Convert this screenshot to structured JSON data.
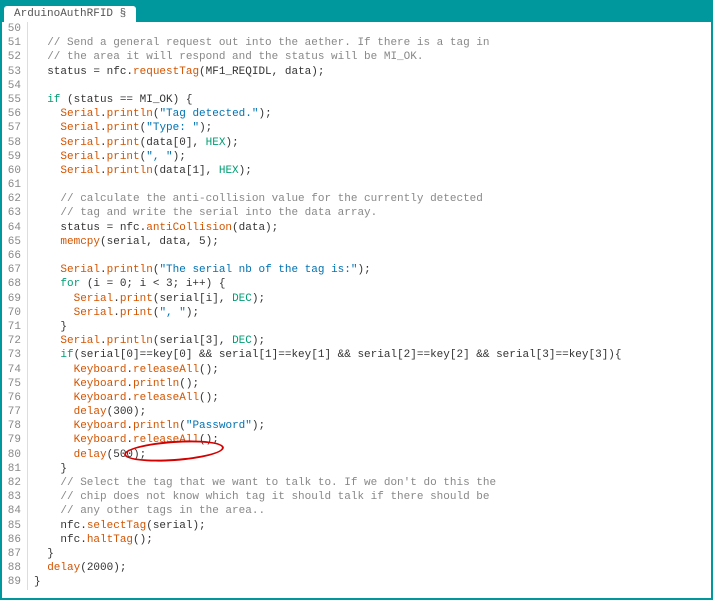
{
  "tab": {
    "label": "ArduinoAuthRFID §"
  },
  "lines": [
    {
      "n": 50,
      "tokens": []
    },
    {
      "n": 51,
      "tokens": [
        {
          "t": "  ",
          "c": "c-black"
        },
        {
          "t": "// Send a general request out into the aether. If there is a tag in",
          "c": "c-comment"
        }
      ]
    },
    {
      "n": 52,
      "tokens": [
        {
          "t": "  ",
          "c": "c-black"
        },
        {
          "t": "// the area it will respond and the status will be MI_OK.",
          "c": "c-comment"
        }
      ]
    },
    {
      "n": 53,
      "tokens": [
        {
          "t": "  status = nfc.",
          "c": "c-black"
        },
        {
          "t": "requestTag",
          "c": "c-orange"
        },
        {
          "t": "(MF1_REQIDL, data);",
          "c": "c-black"
        }
      ]
    },
    {
      "n": 54,
      "tokens": []
    },
    {
      "n": 55,
      "tokens": [
        {
          "t": "  ",
          "c": "c-black"
        },
        {
          "t": "if",
          "c": "c-teal"
        },
        {
          "t": " (status == MI_OK) {",
          "c": "c-black"
        }
      ]
    },
    {
      "n": 56,
      "tokens": [
        {
          "t": "    ",
          "c": "c-black"
        },
        {
          "t": "Serial",
          "c": "c-orange"
        },
        {
          "t": ".",
          "c": "c-black"
        },
        {
          "t": "println",
          "c": "c-orange"
        },
        {
          "t": "(",
          "c": "c-black"
        },
        {
          "t": "\"Tag detected.\"",
          "c": "c-blue"
        },
        {
          "t": ");",
          "c": "c-black"
        }
      ]
    },
    {
      "n": 57,
      "tokens": [
        {
          "t": "    ",
          "c": "c-black"
        },
        {
          "t": "Serial",
          "c": "c-orange"
        },
        {
          "t": ".",
          "c": "c-black"
        },
        {
          "t": "print",
          "c": "c-orange"
        },
        {
          "t": "(",
          "c": "c-black"
        },
        {
          "t": "\"Type: \"",
          "c": "c-blue"
        },
        {
          "t": ");",
          "c": "c-black"
        }
      ]
    },
    {
      "n": 58,
      "tokens": [
        {
          "t": "    ",
          "c": "c-black"
        },
        {
          "t": "Serial",
          "c": "c-orange"
        },
        {
          "t": ".",
          "c": "c-black"
        },
        {
          "t": "print",
          "c": "c-orange"
        },
        {
          "t": "(data[0], ",
          "c": "c-black"
        },
        {
          "t": "HEX",
          "c": "c-teal"
        },
        {
          "t": ");",
          "c": "c-black"
        }
      ]
    },
    {
      "n": 59,
      "tokens": [
        {
          "t": "    ",
          "c": "c-black"
        },
        {
          "t": "Serial",
          "c": "c-orange"
        },
        {
          "t": ".",
          "c": "c-black"
        },
        {
          "t": "print",
          "c": "c-orange"
        },
        {
          "t": "(",
          "c": "c-black"
        },
        {
          "t": "\", \"",
          "c": "c-blue"
        },
        {
          "t": ");",
          "c": "c-black"
        }
      ]
    },
    {
      "n": 60,
      "tokens": [
        {
          "t": "    ",
          "c": "c-black"
        },
        {
          "t": "Serial",
          "c": "c-orange"
        },
        {
          "t": ".",
          "c": "c-black"
        },
        {
          "t": "println",
          "c": "c-orange"
        },
        {
          "t": "(data[1], ",
          "c": "c-black"
        },
        {
          "t": "HEX",
          "c": "c-teal"
        },
        {
          "t": ");",
          "c": "c-black"
        }
      ]
    },
    {
      "n": 61,
      "tokens": []
    },
    {
      "n": 62,
      "tokens": [
        {
          "t": "    ",
          "c": "c-black"
        },
        {
          "t": "// calculate the anti-collision value for the currently detected",
          "c": "c-comment"
        }
      ]
    },
    {
      "n": 63,
      "tokens": [
        {
          "t": "    ",
          "c": "c-black"
        },
        {
          "t": "// tag and write the serial into the data array.",
          "c": "c-comment"
        }
      ]
    },
    {
      "n": 64,
      "tokens": [
        {
          "t": "    status = nfc.",
          "c": "c-black"
        },
        {
          "t": "antiCollision",
          "c": "c-orange"
        },
        {
          "t": "(data);",
          "c": "c-black"
        }
      ]
    },
    {
      "n": 65,
      "tokens": [
        {
          "t": "    ",
          "c": "c-black"
        },
        {
          "t": "memcpy",
          "c": "c-orange"
        },
        {
          "t": "(serial, data, 5);",
          "c": "c-black"
        }
      ]
    },
    {
      "n": 66,
      "tokens": []
    },
    {
      "n": 67,
      "tokens": [
        {
          "t": "    ",
          "c": "c-black"
        },
        {
          "t": "Serial",
          "c": "c-orange"
        },
        {
          "t": ".",
          "c": "c-black"
        },
        {
          "t": "println",
          "c": "c-orange"
        },
        {
          "t": "(",
          "c": "c-black"
        },
        {
          "t": "\"The serial nb of the tag is:\"",
          "c": "c-blue"
        },
        {
          "t": ");",
          "c": "c-black"
        }
      ]
    },
    {
      "n": 68,
      "tokens": [
        {
          "t": "    ",
          "c": "c-black"
        },
        {
          "t": "for",
          "c": "c-teal"
        },
        {
          "t": " (i = 0; i < 3; i++) {",
          "c": "c-black"
        }
      ]
    },
    {
      "n": 69,
      "tokens": [
        {
          "t": "      ",
          "c": "c-black"
        },
        {
          "t": "Serial",
          "c": "c-orange"
        },
        {
          "t": ".",
          "c": "c-black"
        },
        {
          "t": "print",
          "c": "c-orange"
        },
        {
          "t": "(serial[i], ",
          "c": "c-black"
        },
        {
          "t": "DEC",
          "c": "c-teal"
        },
        {
          "t": ");",
          "c": "c-black"
        }
      ]
    },
    {
      "n": 70,
      "tokens": [
        {
          "t": "      ",
          "c": "c-black"
        },
        {
          "t": "Serial",
          "c": "c-orange"
        },
        {
          "t": ".",
          "c": "c-black"
        },
        {
          "t": "print",
          "c": "c-orange"
        },
        {
          "t": "(",
          "c": "c-black"
        },
        {
          "t": "\", \"",
          "c": "c-blue"
        },
        {
          "t": ");",
          "c": "c-black"
        }
      ]
    },
    {
      "n": 71,
      "tokens": [
        {
          "t": "    }",
          "c": "c-black"
        }
      ]
    },
    {
      "n": 72,
      "tokens": [
        {
          "t": "    ",
          "c": "c-black"
        },
        {
          "t": "Serial",
          "c": "c-orange"
        },
        {
          "t": ".",
          "c": "c-black"
        },
        {
          "t": "println",
          "c": "c-orange"
        },
        {
          "t": "(serial[3], ",
          "c": "c-black"
        },
        {
          "t": "DEC",
          "c": "c-teal"
        },
        {
          "t": ");",
          "c": "c-black"
        }
      ]
    },
    {
      "n": 73,
      "tokens": [
        {
          "t": "    ",
          "c": "c-black"
        },
        {
          "t": "if",
          "c": "c-teal"
        },
        {
          "t": "(serial[0]==key[0] && serial[1]==key[1] && serial[2]==key[2] && serial[3]==key[3]){",
          "c": "c-black"
        }
      ]
    },
    {
      "n": 74,
      "tokens": [
        {
          "t": "      ",
          "c": "c-black"
        },
        {
          "t": "Keyboard",
          "c": "c-orange"
        },
        {
          "t": ".",
          "c": "c-black"
        },
        {
          "t": "releaseAll",
          "c": "c-orange"
        },
        {
          "t": "();",
          "c": "c-black"
        }
      ]
    },
    {
      "n": 75,
      "tokens": [
        {
          "t": "      ",
          "c": "c-black"
        },
        {
          "t": "Keyboard",
          "c": "c-orange"
        },
        {
          "t": ".",
          "c": "c-black"
        },
        {
          "t": "println",
          "c": "c-orange"
        },
        {
          "t": "();",
          "c": "c-black"
        }
      ]
    },
    {
      "n": 76,
      "tokens": [
        {
          "t": "      ",
          "c": "c-black"
        },
        {
          "t": "Keyboard",
          "c": "c-orange"
        },
        {
          "t": ".",
          "c": "c-black"
        },
        {
          "t": "releaseAll",
          "c": "c-orange"
        },
        {
          "t": "();",
          "c": "c-black"
        }
      ]
    },
    {
      "n": 77,
      "tokens": [
        {
          "t": "      ",
          "c": "c-black"
        },
        {
          "t": "delay",
          "c": "c-orange"
        },
        {
          "t": "(300);",
          "c": "c-black"
        }
      ]
    },
    {
      "n": 78,
      "tokens": [
        {
          "t": "      ",
          "c": "c-black"
        },
        {
          "t": "Keyboard",
          "c": "c-orange"
        },
        {
          "t": ".",
          "c": "c-black"
        },
        {
          "t": "println",
          "c": "c-orange"
        },
        {
          "t": "(",
          "c": "c-black"
        },
        {
          "t": "\"Password\"",
          "c": "c-blue"
        },
        {
          "t": ");",
          "c": "c-black"
        }
      ]
    },
    {
      "n": 79,
      "tokens": [
        {
          "t": "      ",
          "c": "c-black"
        },
        {
          "t": "Keyboard",
          "c": "c-orange"
        },
        {
          "t": ".",
          "c": "c-black"
        },
        {
          "t": "releaseAll",
          "c": "c-orange"
        },
        {
          "t": "();",
          "c": "c-black"
        }
      ]
    },
    {
      "n": 80,
      "tokens": [
        {
          "t": "      ",
          "c": "c-black"
        },
        {
          "t": "delay",
          "c": "c-orange"
        },
        {
          "t": "(500);",
          "c": "c-black"
        }
      ]
    },
    {
      "n": 81,
      "tokens": [
        {
          "t": "    }",
          "c": "c-black"
        }
      ]
    },
    {
      "n": 82,
      "tokens": [
        {
          "t": "    ",
          "c": "c-black"
        },
        {
          "t": "// Select the tag that we want to talk to. If we don't do this the",
          "c": "c-comment"
        }
      ]
    },
    {
      "n": 83,
      "tokens": [
        {
          "t": "    ",
          "c": "c-black"
        },
        {
          "t": "// chip does not know which tag it should talk if there should be",
          "c": "c-comment"
        }
      ]
    },
    {
      "n": 84,
      "tokens": [
        {
          "t": "    ",
          "c": "c-black"
        },
        {
          "t": "// any other tags in the area..",
          "c": "c-comment"
        }
      ]
    },
    {
      "n": 85,
      "tokens": [
        {
          "t": "    nfc.",
          "c": "c-black"
        },
        {
          "t": "selectTag",
          "c": "c-orange"
        },
        {
          "t": "(serial);",
          "c": "c-black"
        }
      ]
    },
    {
      "n": 86,
      "tokens": [
        {
          "t": "    nfc.",
          "c": "c-black"
        },
        {
          "t": "haltTag",
          "c": "c-orange"
        },
        {
          "t": "();",
          "c": "c-black"
        }
      ]
    },
    {
      "n": 87,
      "tokens": [
        {
          "t": "  }",
          "c": "c-black"
        }
      ]
    },
    {
      "n": 88,
      "tokens": [
        {
          "t": "  ",
          "c": "c-black"
        },
        {
          "t": "delay",
          "c": "c-orange"
        },
        {
          "t": "(2000);",
          "c": "c-black"
        }
      ]
    },
    {
      "n": 89,
      "tokens": [
        {
          "t": "}",
          "c": "c-black"
        }
      ]
    }
  ]
}
